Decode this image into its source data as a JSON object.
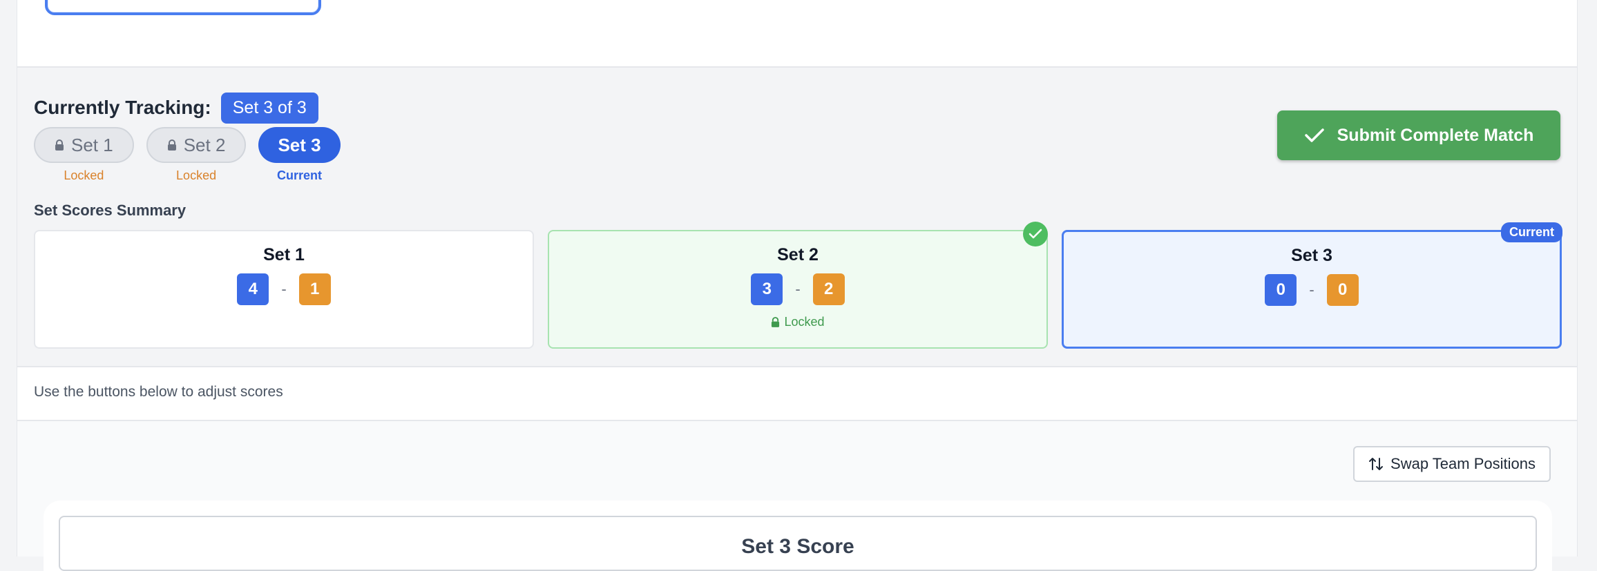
{
  "tracking": {
    "label": "Currently Tracking:",
    "badge": "Set 3 of 3"
  },
  "set_pills": [
    {
      "label": "Set 1",
      "state": "Locked"
    },
    {
      "label": "Set 2",
      "state": "Locked"
    },
    {
      "label": "Set 3",
      "state": "Current"
    }
  ],
  "submit_label": "Submit Complete Match",
  "summary": {
    "label": "Set Scores Summary",
    "cards": [
      {
        "title": "Set 1",
        "home": "4",
        "away": "1"
      },
      {
        "title": "Set 2",
        "home": "3",
        "away": "2",
        "status": "Locked"
      },
      {
        "title": "Set 3",
        "home": "0",
        "away": "0",
        "tag": "Current"
      }
    ],
    "separator": "-"
  },
  "hint": "Use the buttons below to adjust scores",
  "swap_label": "Swap Team Positions",
  "score_panel_title": "Set 3 Score",
  "colors": {
    "primary": "#3b6be6",
    "success": "#4ea45a",
    "orange": "#e7962e",
    "locked_text": "#d9822b"
  }
}
